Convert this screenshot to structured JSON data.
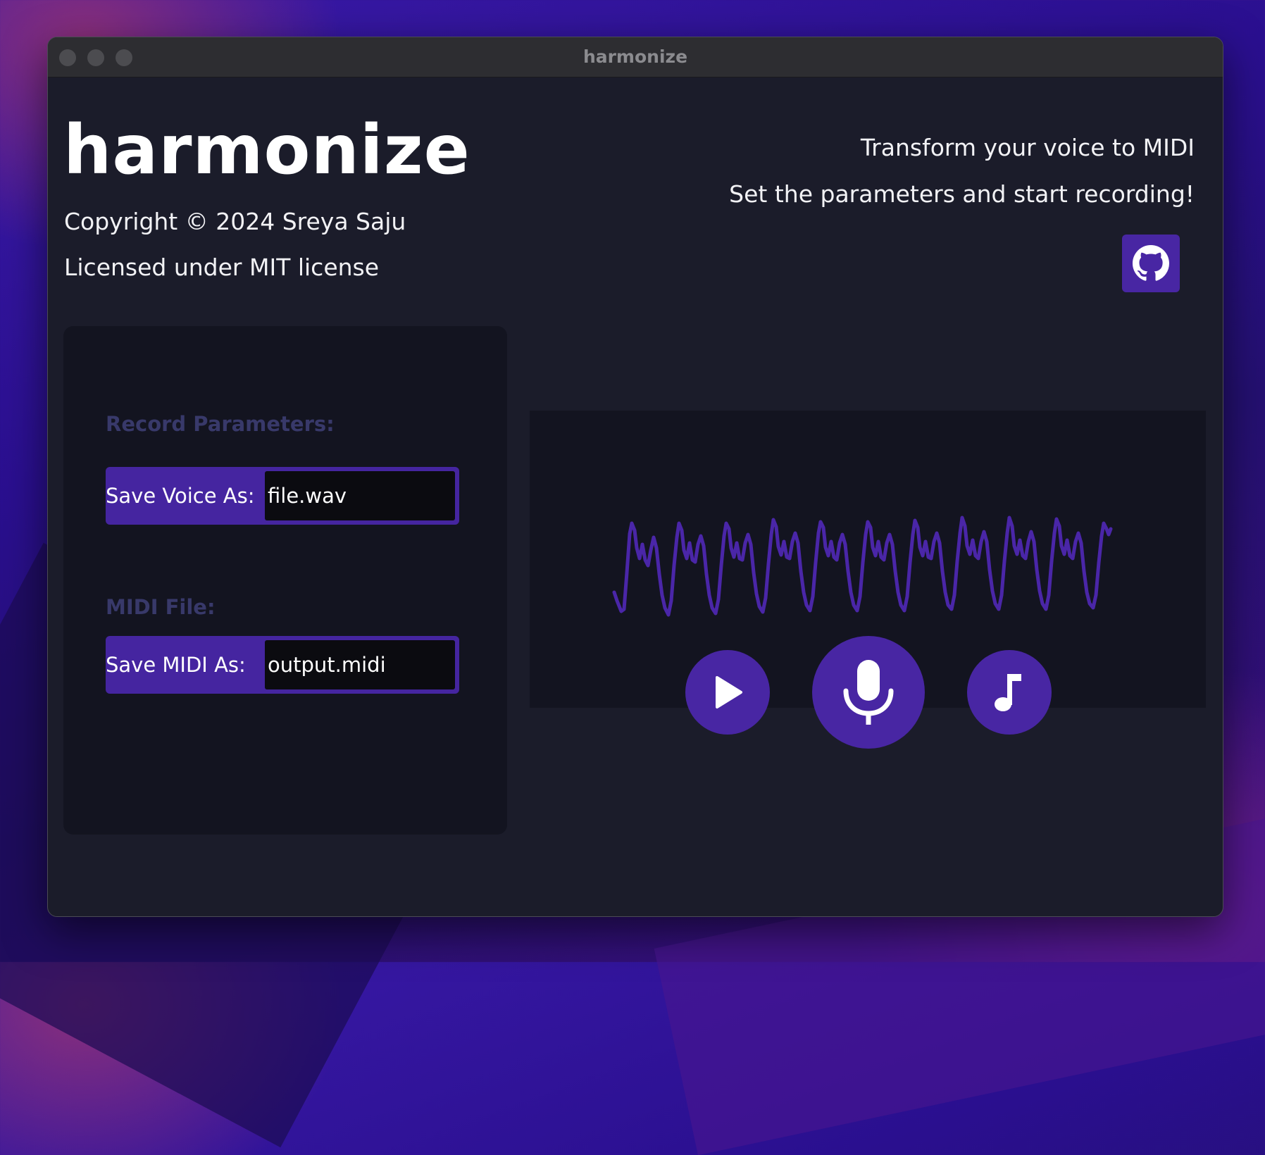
{
  "window": {
    "title": "harmonize"
  },
  "header": {
    "app_title": "harmonize",
    "copyright": "Copyright © 2024 Sreya Saju",
    "license": "Licensed under MIT license",
    "tagline": "Transform your voice to MIDI",
    "instruction": "Set the parameters and start recording!",
    "github_icon": "github-icon"
  },
  "params": {
    "record_heading": "Record Parameters:",
    "voice_label": "Save Voice As:",
    "voice_value": "file.wav",
    "midi_heading": "MIDI File:",
    "midi_label": "Save MIDI As:",
    "midi_value": "output.midi"
  },
  "controls": {
    "play_icon": "play-icon",
    "record_icon": "microphone-icon",
    "midi_icon": "music-note-icon"
  },
  "colors": {
    "accent": "#4826a3",
    "window_bg": "#1b1c2a",
    "panel_bg": "#131420",
    "waveform": "#4a26a8",
    "section_label": "#38396a"
  }
}
